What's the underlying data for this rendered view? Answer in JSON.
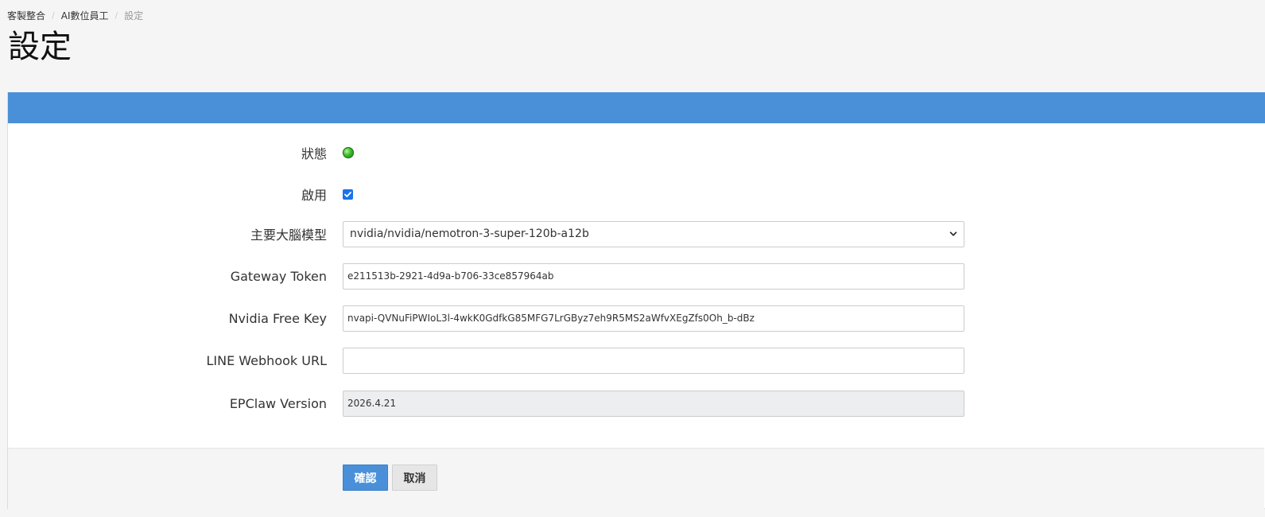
{
  "breadcrumb": [
    {
      "label": "客製整合"
    },
    {
      "label": "AI數位員工"
    },
    {
      "label": "設定"
    }
  ],
  "breadcrumb_separator": "/",
  "page": {
    "title": "設定"
  },
  "form": {
    "status": {
      "label": "狀態",
      "state": "online",
      "color": "#3dbd2c"
    },
    "enabled": {
      "label": "啟用",
      "checked": true
    },
    "model": {
      "label": "主要大腦模型",
      "value": "nvidia/nvidia/nemotron-3-super-120b-a12b"
    },
    "gateway_token": {
      "label": "Gateway Token",
      "value": "e211513b-2921-4d9a-b706-33ce857964ab"
    },
    "nvidia_key": {
      "label": "Nvidia Free Key",
      "value": "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"
    },
    "line_webhook": {
      "label": "LINE Webhook URL",
      "value": ""
    },
    "version": {
      "label": "EPClaw Version",
      "value": "2026.4.21"
    }
  },
  "buttons": {
    "confirm": "確認",
    "cancel": "取消"
  },
  "colors": {
    "primary": "#4a90d9",
    "panel_header": "#4a90d9",
    "checkbox": "#1a73e8"
  }
}
